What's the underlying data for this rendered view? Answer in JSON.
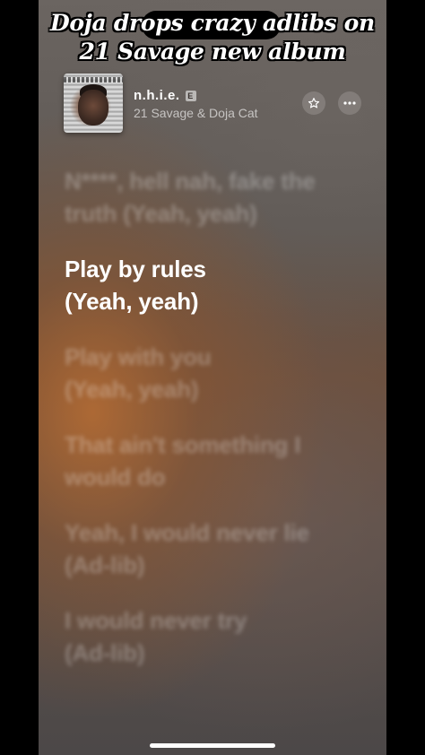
{
  "caption": {
    "line1": "Doja drops crazy adlibs on",
    "line2": "21 Savage new album"
  },
  "now_playing": {
    "title": "n.h.i.e.",
    "explicit_badge": "E",
    "artist": "21 Savage & Doja Cat"
  },
  "controls": {
    "star_icon": "star-icon",
    "more_icon": "ellipsis-icon"
  },
  "lyrics": [
    {
      "l1": "N****, hell nah, fake the",
      "l2": "truth (Yeah, yeah)",
      "state": "past"
    },
    {
      "l1": "Play by rules",
      "l2": "(Yeah, yeah)",
      "state": "current"
    },
    {
      "l1": "Play with you",
      "l2": "(Yeah, yeah)",
      "state": "upcoming"
    },
    {
      "l1": "That ain't something I",
      "l2": "would do",
      "state": "upcoming"
    },
    {
      "l1": "Yeah, I would never lie",
      "l2": "(Ad-lib)",
      "state": "upcoming"
    },
    {
      "l1": "I would never try",
      "l2": "(Ad-lib)",
      "state": "upcoming"
    }
  ]
}
